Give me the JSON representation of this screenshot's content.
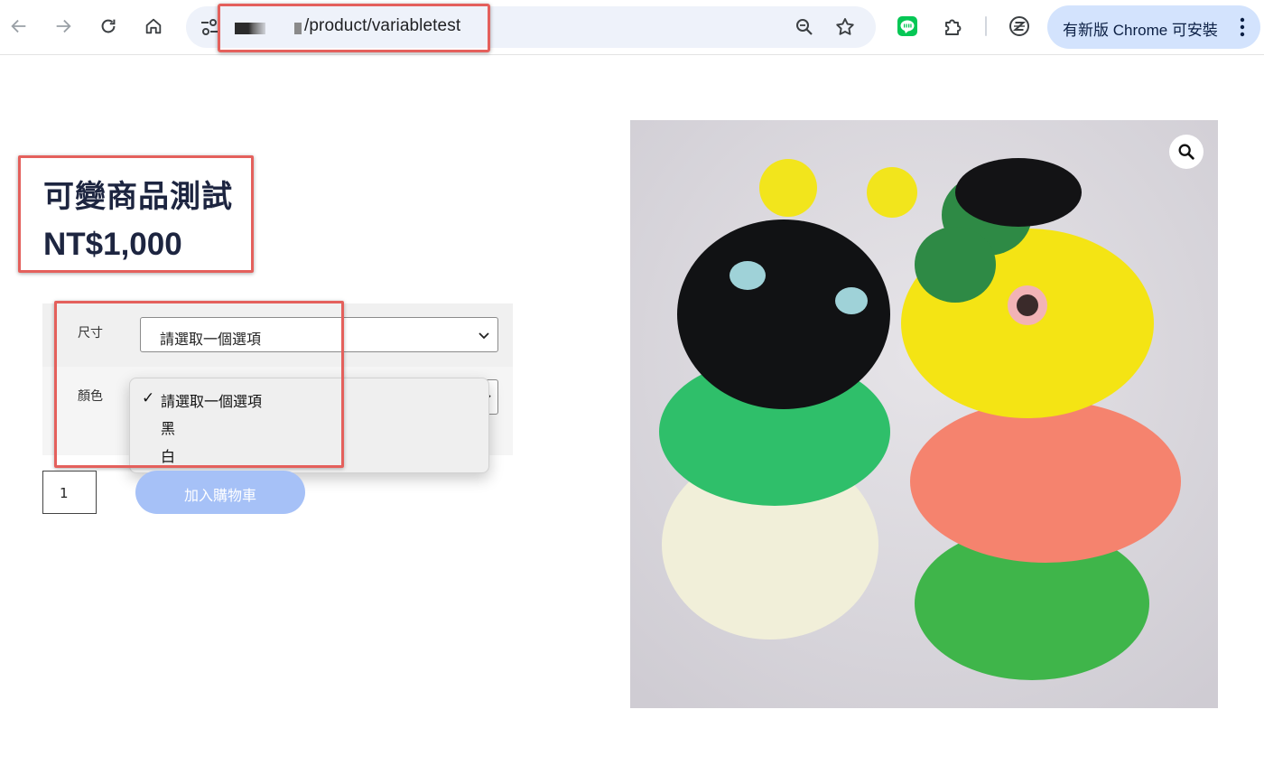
{
  "browser": {
    "url_path": "/product/variabletest",
    "update_button": "有新版 Chrome 可安裝"
  },
  "product": {
    "title": "可變商品測試",
    "price": "NT$1,000",
    "variations": {
      "size": {
        "label": "尺寸",
        "selected": "請選取一個選項"
      },
      "color": {
        "label": "顏色",
        "selected": "請選取一個選項",
        "options": [
          "請選取一個選項",
          "黑",
          "白"
        ]
      }
    },
    "quantity": "1",
    "add_to_cart": "加入購物車"
  },
  "icons": {
    "back": "arrow-left-icon",
    "forward": "arrow-right-icon",
    "reload": "reload-icon",
    "home": "home-icon",
    "site_info": "tune-icon",
    "zoom": "zoom-icon",
    "bookmark": "star-icon",
    "line": "line-app-icon",
    "extensions": "puzzle-icon",
    "z_extension": "z-icon",
    "menu": "kebab-icon",
    "image_zoom": "magnifier-icon"
  },
  "colors": {
    "highlight": "#e4605c",
    "text_dark": "#1d2540",
    "add_to_cart": "#a6c1f7",
    "update_pill": "#d3e3fd"
  }
}
